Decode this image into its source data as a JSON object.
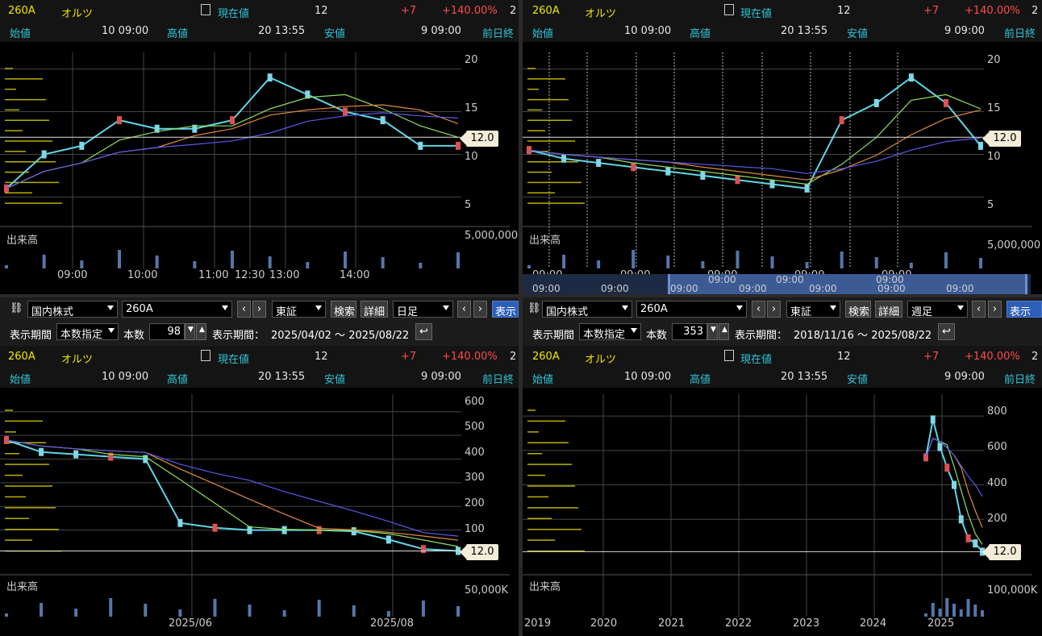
{
  "quote": {
    "code": "260A",
    "name": "オルツ",
    "current_label": "現在値",
    "current_value": "12",
    "change": "+7",
    "change_pct": "+140.00%",
    "trunc": "2",
    "open_label": "始値",
    "open_value": "10 09:00",
    "high_label": "高値",
    "high_value": "20 13:55",
    "low_label": "安値",
    "low_value": "9 09:00",
    "prev_label": "前日終"
  },
  "panels": {
    "tl": {
      "yticks": [
        "20",
        "15",
        "10",
        "5"
      ],
      "xticks": [
        "09:00",
        "10:00",
        "11:00",
        "12:30",
        "13:00",
        "14:00"
      ],
      "price_tag": "12.0",
      "volume_label": "出来高",
      "volume_tick": "5,000,000"
    },
    "tr": {
      "yticks": [
        "20",
        "15",
        "10",
        "5"
      ],
      "xticks": [
        "09:00",
        "09:00",
        "09:00",
        "09:00",
        "09:00"
      ],
      "scroll_ticks": [
        "09:00",
        "09:00",
        "09:00",
        "09:00",
        "09:00",
        "09:00",
        "09:00",
        "09:00",
        "09:00",
        "09:00"
      ],
      "price_tag": "12.0",
      "volume_label": "出来高",
      "volume_tick": "5,000,000"
    },
    "bl": {
      "yticks": [
        "600",
        "500",
        "400",
        "300",
        "200",
        "100"
      ],
      "xticks": [
        "2025/06",
        "2025/08"
      ],
      "price_tag": "12.0",
      "volume_label": "出来高",
      "volume_tick": "50,000K"
    },
    "br": {
      "yticks": [
        "800",
        "600",
        "400",
        "200"
      ],
      "xticks": [
        "2019",
        "2020",
        "2021",
        "2022",
        "2023",
        "2024",
        "2025"
      ],
      "price_tag": "12.0",
      "volume_label": "出来高",
      "volume_tick": "100,000K"
    }
  },
  "toolbar_left": {
    "market": "国内株式",
    "code": "260A",
    "exchange": "東証",
    "search": "検索",
    "detail": "詳細",
    "period": "日足",
    "display": "表示",
    "range_label": "表示期間",
    "range_mode": "本数指定",
    "count_label": "本数",
    "count": "98",
    "span_label": "表示期間：",
    "span": "2025/04/02 〜 2025/08/22"
  },
  "toolbar_right": {
    "market": "国内株式",
    "code": "260A",
    "exchange": "東証",
    "search": "検索",
    "detail": "詳細",
    "period": "週足",
    "display": "表示",
    "range_label": "表示期間",
    "range_mode": "本数指定",
    "count_label": "本数",
    "count": "353",
    "span_label": "表示期間：",
    "span": "2018/11/16 〜 2025/08/22"
  },
  "chart_data": [
    {
      "type": "line",
      "title": "",
      "panel": "intraday 1-day",
      "ylim": [
        4,
        21
      ],
      "xcats": [
        "09:00",
        "10:00",
        "11:00",
        "12:30",
        "13:00",
        "14:00"
      ],
      "series": [
        {
          "values": [
            6,
            10,
            11,
            14,
            13,
            13,
            14,
            19,
            17,
            15,
            14,
            11,
            11
          ]
        }
      ],
      "last": 12
    },
    {
      "type": "line",
      "title": "",
      "panel": "intraday multi-day",
      "ylim": [
        4,
        21
      ],
      "series": [
        {
          "values": [
            10.5,
            9.5,
            9,
            8.5,
            8,
            7.5,
            7,
            6.5,
            6,
            14,
            16,
            19,
            16,
            11
          ]
        }
      ],
      "last": 12
    },
    {
      "type": "line",
      "title": "",
      "panel": "daily",
      "ylim": [
        0,
        640
      ],
      "xcats": [
        "2025/06",
        "2025/08"
      ],
      "series": [
        {
          "values": [
            480,
            430,
            420,
            410,
            400,
            130,
            110,
            100,
            100,
            100,
            95,
            60,
            20,
            12
          ]
        }
      ],
      "last": 12
    },
    {
      "type": "line",
      "title": "",
      "panel": "weekly",
      "ylim": [
        0,
        880
      ],
      "xcats": [
        "2019",
        "2020",
        "2021",
        "2022",
        "2023",
        "2024",
        "2025"
      ],
      "series": [
        {
          "values": [
            560,
            780,
            620,
            500,
            400,
            200,
            90,
            60,
            12
          ]
        }
      ],
      "last": 12
    }
  ]
}
